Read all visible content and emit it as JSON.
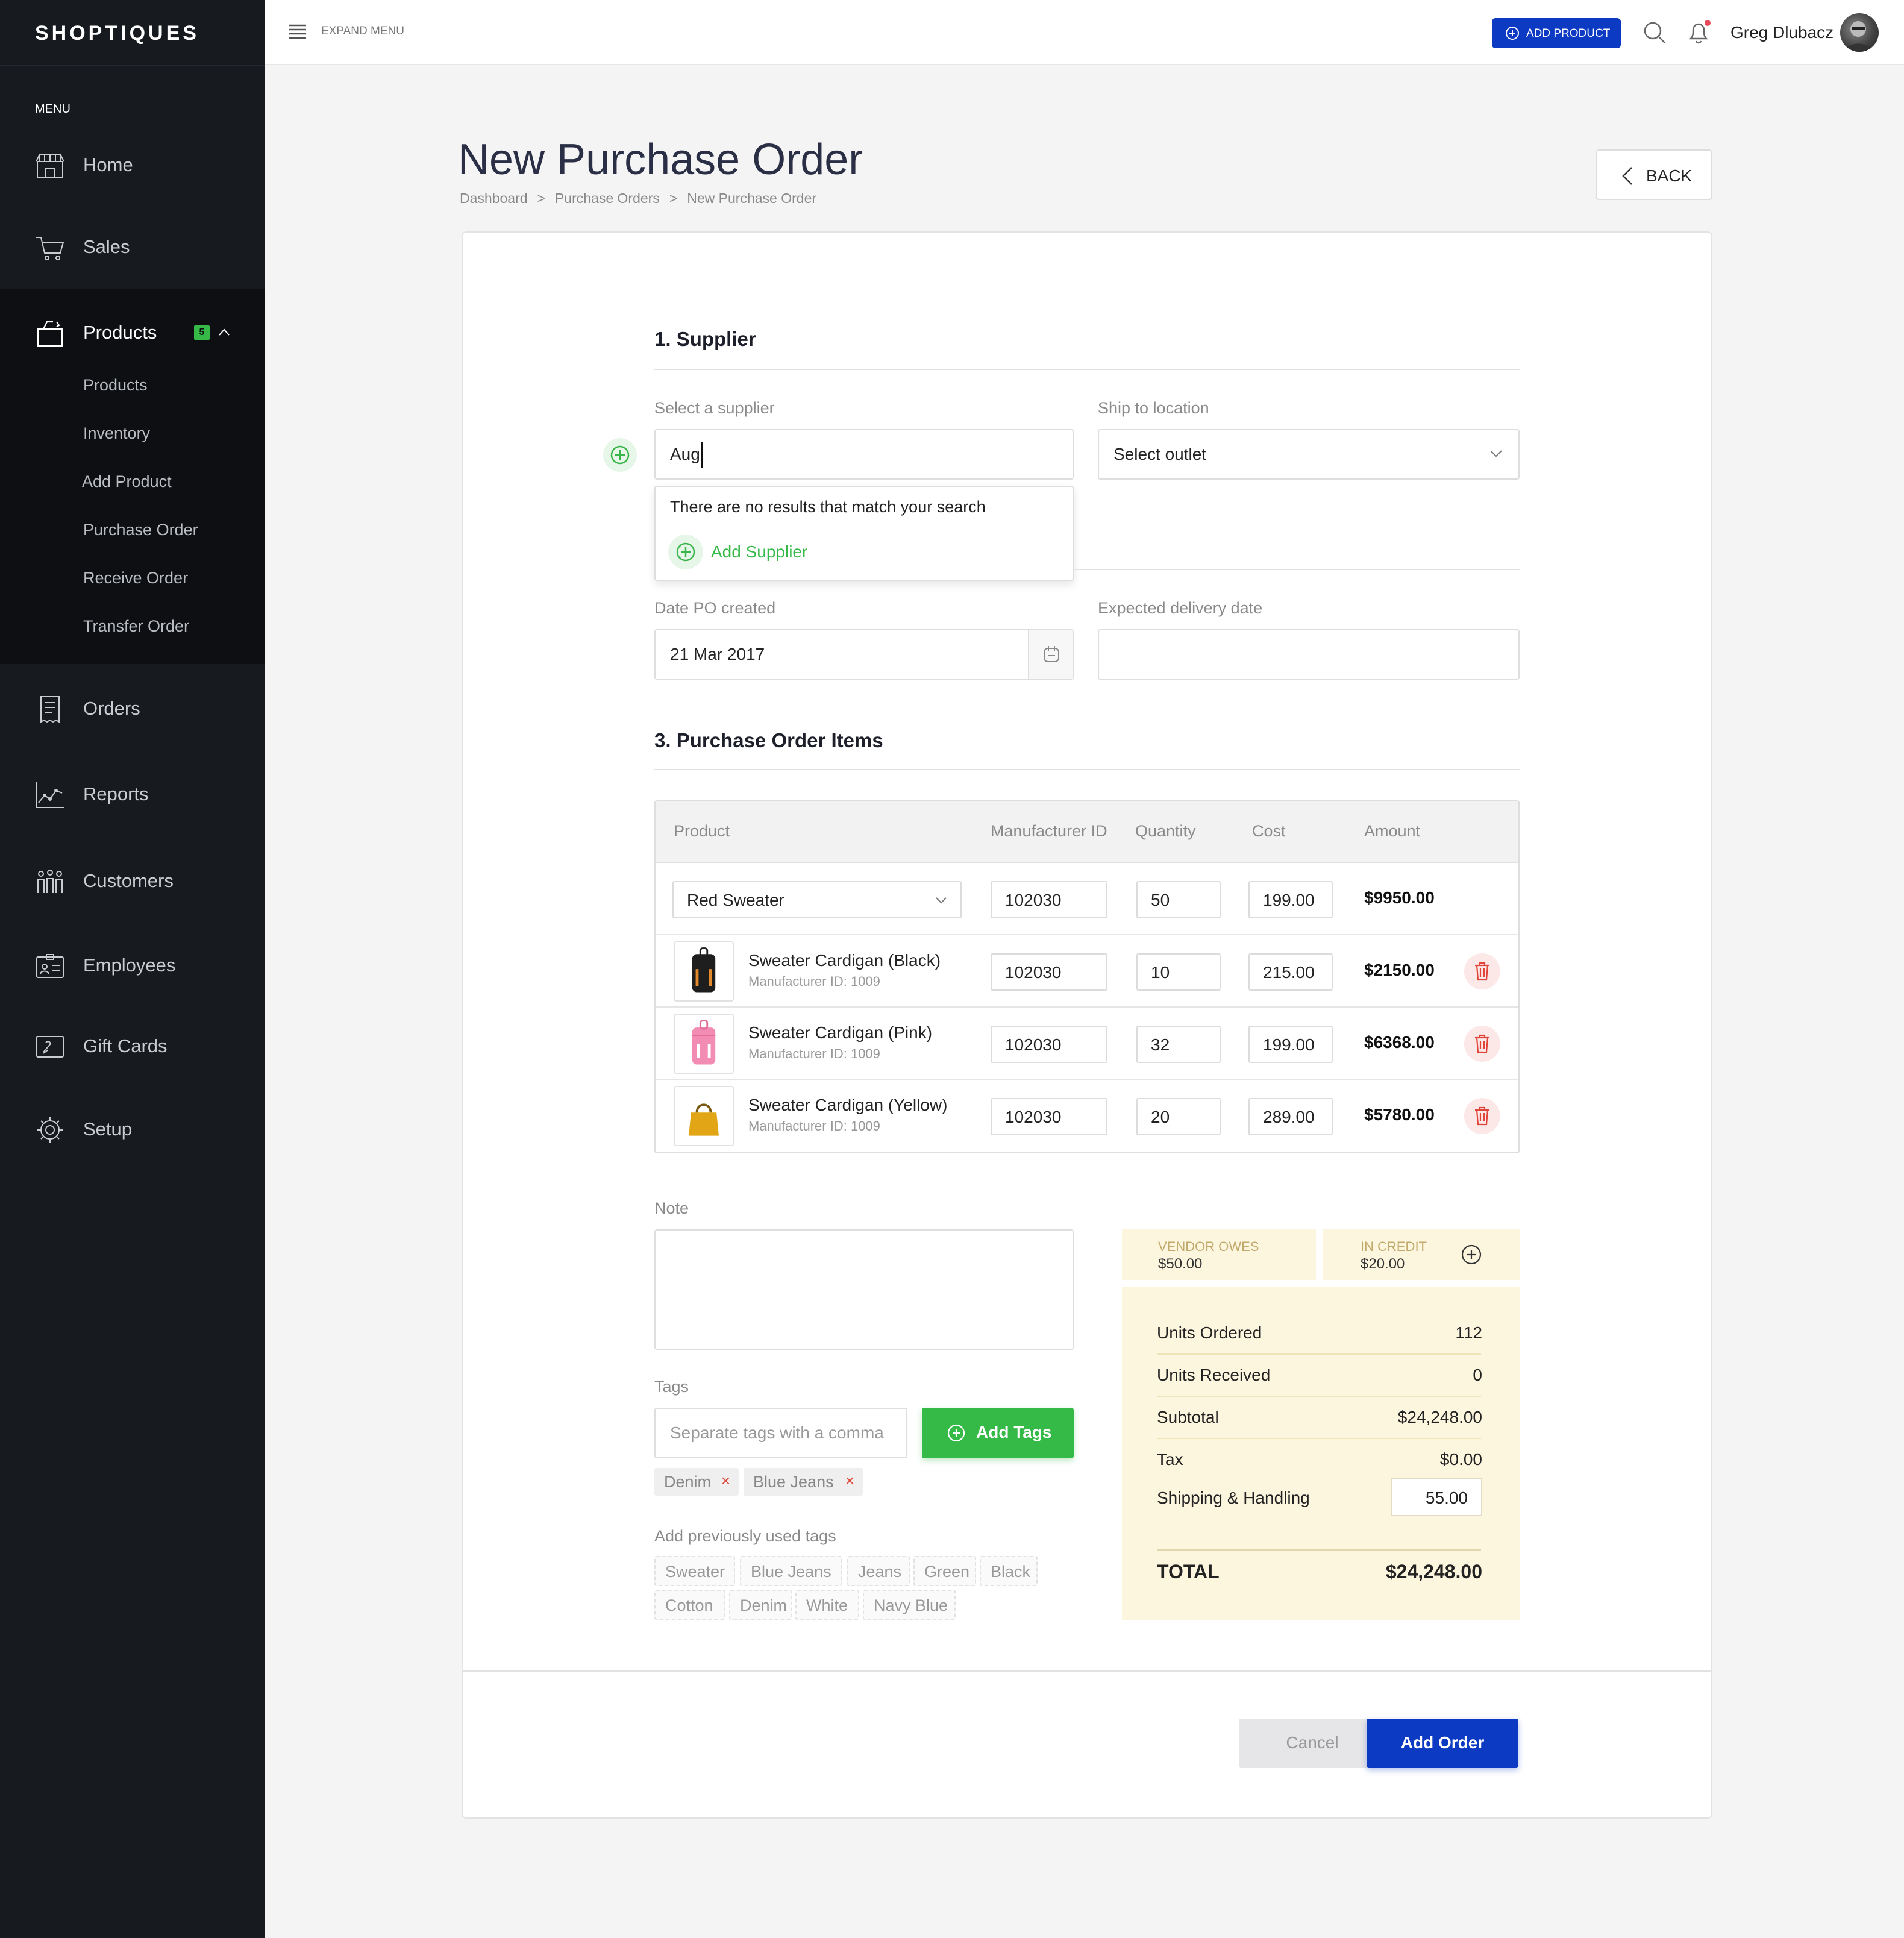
{
  "brand": "SHOPTIQUES",
  "sidebar": {
    "menu_label": "MENU",
    "items": [
      {
        "label": "Home"
      },
      {
        "label": "Sales"
      },
      {
        "label": "Products",
        "badge": "5"
      },
      {
        "label": "Orders"
      },
      {
        "label": "Reports"
      },
      {
        "label": "Customers"
      },
      {
        "label": "Employees"
      },
      {
        "label": "Gift Cards"
      },
      {
        "label": "Setup"
      }
    ],
    "product_subitems": [
      "Products",
      "Inventory",
      "Add Product",
      "Purchase Order",
      "Receive Order",
      "Transfer Order"
    ]
  },
  "topbar": {
    "expand_menu": "EXPAND MENU",
    "add_product": "ADD PRODUCT",
    "user_name": "Greg Dlubacz"
  },
  "page": {
    "title": "New Purchase Order",
    "breadcrumb": [
      "Dashboard",
      "Purchase Orders",
      "New Purchase Order"
    ],
    "back_label": "BACK"
  },
  "supplier_section": {
    "title": "1. Supplier",
    "supplier_label": "Select a supplier",
    "supplier_value": "Aug",
    "ship_label": "Ship to location",
    "ship_value": "Select outlet",
    "no_results": "There are no results that match your search",
    "add_supplier": "Add Supplier"
  },
  "dates": {
    "created_label": "Date PO created",
    "created_value": "21 Mar 2017",
    "expected_label": "Expected delivery date",
    "expected_value": ""
  },
  "items_section": {
    "title": "3. Purchase Order Items",
    "columns": [
      "Product",
      "Manufacturer ID",
      "Quantity",
      "Cost",
      "Amount"
    ],
    "rows": [
      {
        "product": "Red Sweater",
        "meta": "",
        "mfr_id": "102030",
        "qty": "50",
        "cost": "199.00",
        "amount": "$9950.00"
      },
      {
        "product": "Sweater Cardigan (Black)",
        "meta": "Manufacturer ID: 1009",
        "mfr_id": "102030",
        "qty": "10",
        "cost": "215.00",
        "amount": "$2150.00"
      },
      {
        "product": "Sweater Cardigan (Pink)",
        "meta": "Manufacturer ID: 1009",
        "mfr_id": "102030",
        "qty": "32",
        "cost": "199.00",
        "amount": "$6368.00"
      },
      {
        "product": "Sweater Cardigan (Yellow)",
        "meta": "Manufacturer ID: 1009",
        "mfr_id": "102030",
        "qty": "20",
        "cost": "289.00",
        "amount": "$5780.00"
      }
    ]
  },
  "note": {
    "label": "Note",
    "value": ""
  },
  "tags": {
    "label": "Tags",
    "placeholder": "Separate tags with a comma",
    "add_button": "Add Tags",
    "current": [
      "Denim",
      "Blue Jeans"
    ],
    "previous_label": "Add previously used tags",
    "previous": [
      "Sweater",
      "Blue Jeans",
      "Jeans",
      "Green",
      "Black",
      "Cotton",
      "Denim",
      "White",
      "Navy Blue"
    ]
  },
  "summary": {
    "vendor_owes_label": "VENDOR OWES",
    "vendor_owes_value": "$50.00",
    "in_credit_label": "IN CREDIT",
    "in_credit_value": "$20.00",
    "rows": [
      {
        "label": "Units Ordered",
        "value": "112"
      },
      {
        "label": "Units Received",
        "value": "0"
      },
      {
        "label": "Subtotal",
        "value": "$24,248.00"
      },
      {
        "label": "Tax",
        "value": "$0.00"
      },
      {
        "label": "Shipping & Handling",
        "value": "55.00"
      }
    ],
    "total_label": "TOTAL",
    "total_value": "$24,248.00"
  },
  "footer": {
    "cancel": "Cancel",
    "add_order": "Add Order"
  },
  "colors": {
    "sidebar": "#171b20",
    "accent_blue": "#0c3ac2",
    "green": "#35b947",
    "summary_bg": "#fdf6df"
  }
}
